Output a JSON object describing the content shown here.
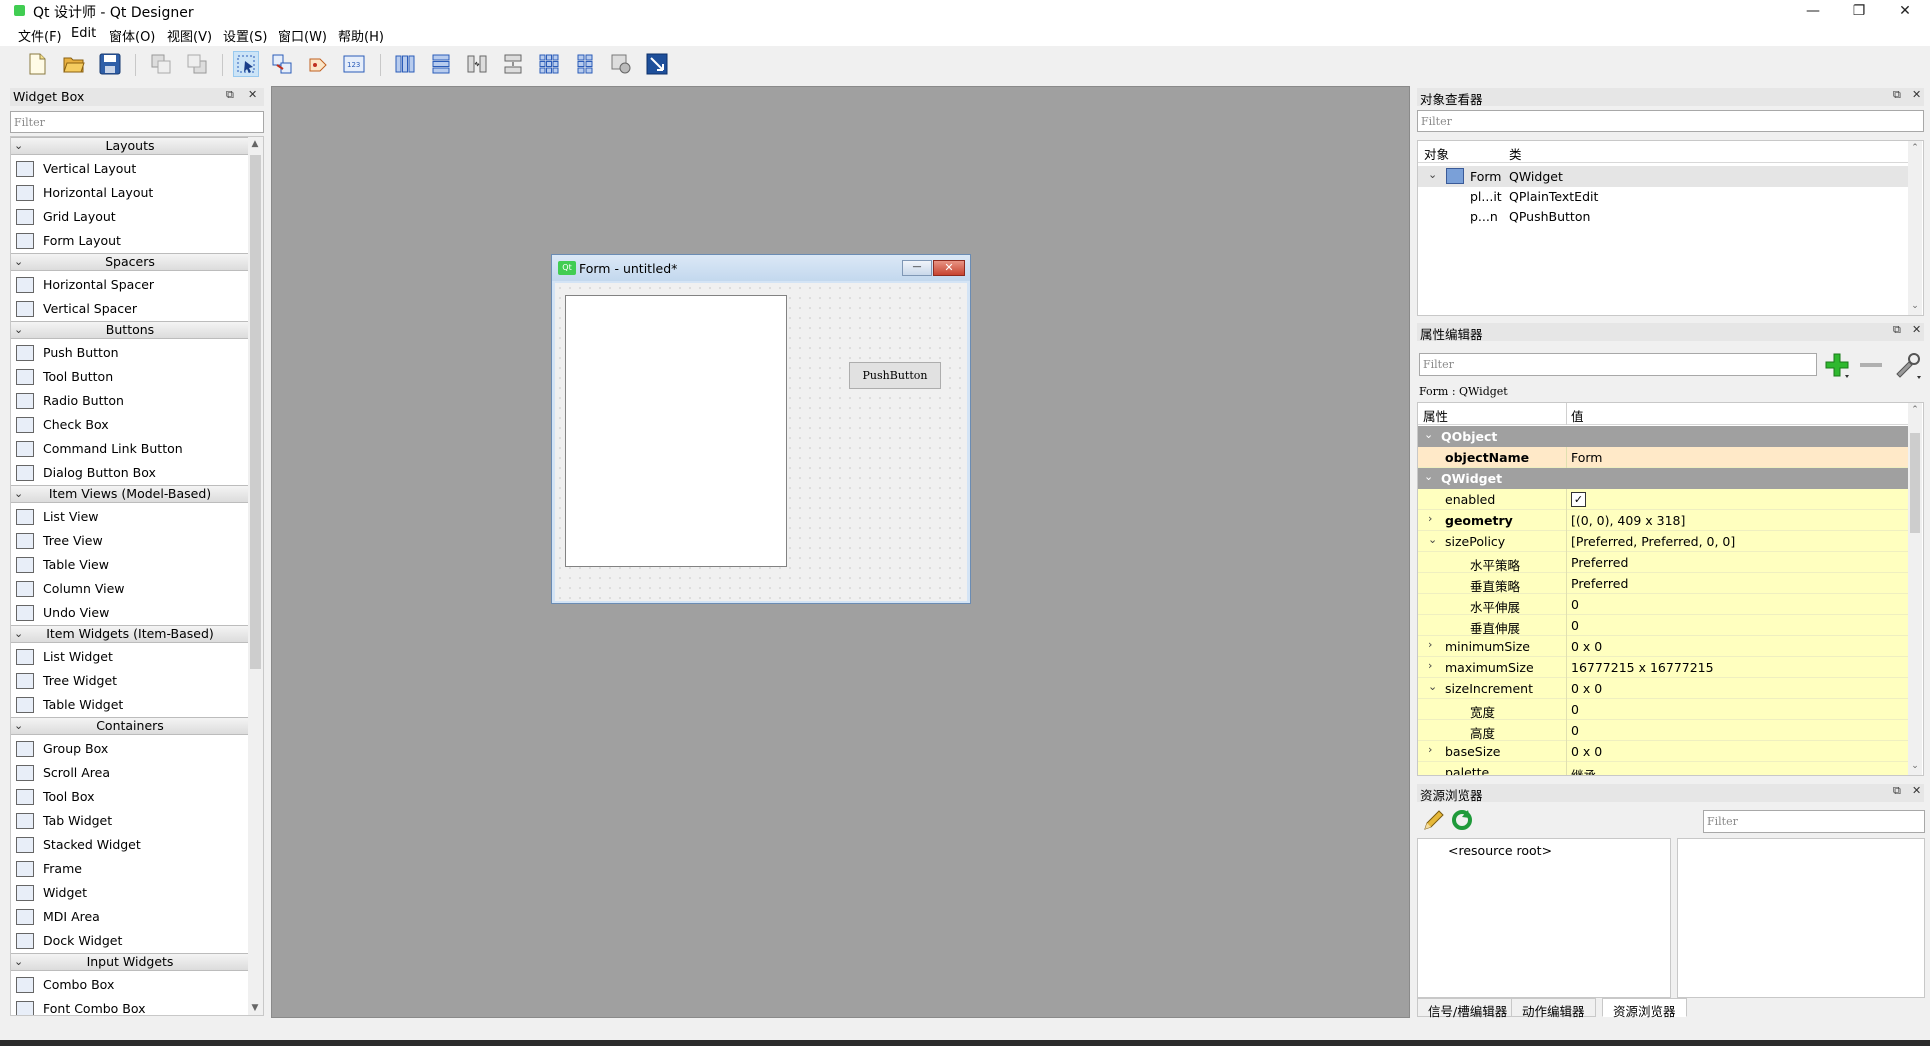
{
  "window": {
    "title": "Qt 设计师 - Qt Designer",
    "min": "—",
    "max": "❐",
    "close": "✕"
  },
  "menu": [
    "文件(F)",
    "Edit",
    "窗体(O)",
    "视图(V)",
    "设置(S)",
    "窗口(W)",
    "帮助(H)"
  ],
  "toolbar": [
    "new-file-icon",
    "open-file-icon",
    "save-icon",
    "send-to-back-icon",
    "bring-to-front-icon",
    "edit-widgets-icon",
    "edit-signals-slots-icon",
    "edit-buddies-icon",
    "edit-tab-order-icon",
    "layout-horizontal-icon",
    "layout-vertical-icon",
    "layout-horizontal-splitter-icon",
    "layout-vertical-splitter-icon",
    "layout-grid-icon",
    "layout-form-icon",
    "break-layout-icon",
    "adjust-size-icon"
  ],
  "widget_box": {
    "title": "Widget Box",
    "filter": "Filter",
    "sections": [
      {
        "label": "Layouts",
        "items": [
          "Vertical Layout",
          "Horizontal Layout",
          "Grid Layout",
          "Form Layout"
        ]
      },
      {
        "label": "Spacers",
        "items": [
          "Horizontal Spacer",
          "Vertical Spacer"
        ]
      },
      {
        "label": "Buttons",
        "items": [
          "Push Button",
          "Tool Button",
          "Radio Button",
          "Check Box",
          "Command Link Button",
          "Dialog Button Box"
        ]
      },
      {
        "label": "Item Views (Model-Based)",
        "items": [
          "List View",
          "Tree View",
          "Table View",
          "Column View",
          "Undo View"
        ]
      },
      {
        "label": "Item Widgets (Item-Based)",
        "items": [
          "List Widget",
          "Tree Widget",
          "Table Widget"
        ]
      },
      {
        "label": "Containers",
        "items": [
          "Group Box",
          "Scroll Area",
          "Tool Box",
          "Tab Widget",
          "Stacked Widget",
          "Frame",
          "Widget",
          "MDI Area",
          "Dock Widget"
        ]
      },
      {
        "label": "Input Widgets",
        "items": [
          "Combo Box",
          "Font Combo Box"
        ]
      }
    ]
  },
  "form": {
    "title": "Form - untitled*",
    "button": "PushButton",
    "qt_badge": "Qt"
  },
  "object_inspector": {
    "title": "对象查看器",
    "filter": "Filter",
    "headers": [
      "对象",
      "类"
    ],
    "rows": [
      {
        "object": "Form",
        "class": "QWidget",
        "selected": true
      },
      {
        "object": "pl...it",
        "class": "QPlainTextEdit"
      },
      {
        "object": "p...n",
        "class": "QPushButton"
      }
    ]
  },
  "property_editor": {
    "title": "属性编辑器",
    "filter": "Filter",
    "context": "Form : QWidget",
    "headers": [
      "属性",
      "值"
    ],
    "rows": [
      {
        "kind": "group",
        "name": "QObject"
      },
      {
        "kind": "prop",
        "name": "objectName",
        "value": "Form",
        "bold": true,
        "bg": "#ffe9c8"
      },
      {
        "kind": "group",
        "name": "QWidget"
      },
      {
        "kind": "prop",
        "name": "enabled",
        "value": "✓",
        "check": true,
        "bg": "#ffffbf"
      },
      {
        "kind": "prop",
        "name": "geometry",
        "value": "[(0, 0), 409 x 318]",
        "bold": true,
        "expander": "›",
        "bg": "#ffffbf"
      },
      {
        "kind": "prop",
        "name": "sizePolicy",
        "value": "[Preferred, Preferred, 0, 0]",
        "expander": "⌄",
        "bg": "#ffffbf"
      },
      {
        "kind": "sub",
        "name": "水平策略",
        "value": "Preferred",
        "bg": "#ffffbf"
      },
      {
        "kind": "sub",
        "name": "垂直策略",
        "value": "Preferred",
        "bg": "#ffffbf"
      },
      {
        "kind": "sub",
        "name": "水平伸展",
        "value": "0",
        "bg": "#ffffbf"
      },
      {
        "kind": "sub",
        "name": "垂直伸展",
        "value": "0",
        "bg": "#ffffbf"
      },
      {
        "kind": "prop",
        "name": "minimumSize",
        "value": "0 x 0",
        "expander": "›",
        "bg": "#ffffbf"
      },
      {
        "kind": "prop",
        "name": "maximumSize",
        "value": "16777215 x 16777215",
        "expander": "›",
        "bg": "#ffffbf"
      },
      {
        "kind": "prop",
        "name": "sizeIncrement",
        "value": "0 x 0",
        "expander": "⌄",
        "bg": "#ffffbf"
      },
      {
        "kind": "sub",
        "name": "宽度",
        "value": "0",
        "bg": "#ffffbf"
      },
      {
        "kind": "sub",
        "name": "高度",
        "value": "0",
        "bg": "#ffffbf"
      },
      {
        "kind": "prop",
        "name": "baseSize",
        "value": "0 x 0",
        "expander": "›",
        "bg": "#ffffbf"
      },
      {
        "kind": "prop",
        "name": "palette",
        "value": "继承",
        "bg": "#ffffbf"
      }
    ]
  },
  "resource_browser": {
    "title": "资源浏览器",
    "filter": "Filter",
    "root": "<resource root>"
  },
  "bottom_tabs": [
    "信号/槽编辑器",
    "动作编辑器",
    "资源浏览器"
  ],
  "colors": {
    "canvas": "#a0a0a0",
    "group_header": "#a0a0a0",
    "prop_yellow": "#ffffbf",
    "prop_orange": "#ffe9c8",
    "accent_green": "#41cd52"
  }
}
